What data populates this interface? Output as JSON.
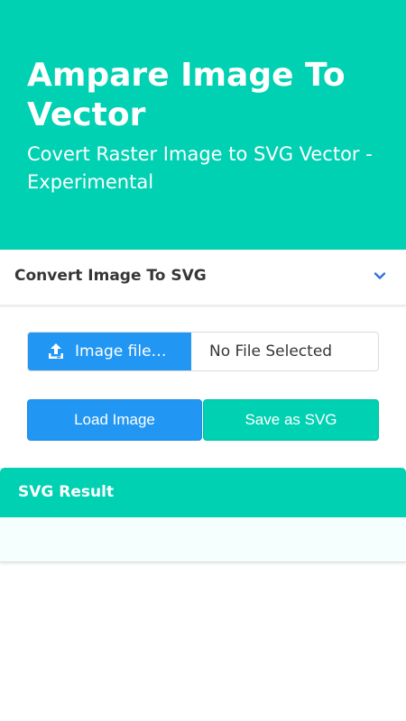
{
  "hero": {
    "title": "Ampare Image To Vector",
    "subtitle": "Covert Raster Image to SVG Vector - Experimental"
  },
  "converter": {
    "header_title": "Convert Image To SVG",
    "toggle_icon": "chevron-down-icon",
    "file_button_label": "Image file…",
    "file_icon": "upload-icon",
    "file_name": "No File Selected",
    "load_button_label": "Load Image",
    "save_button_label": "Save as SVG"
  },
  "result": {
    "header_title": "SVG Result"
  },
  "colors": {
    "primary": "#00d1b2",
    "info": "#2196f3"
  }
}
